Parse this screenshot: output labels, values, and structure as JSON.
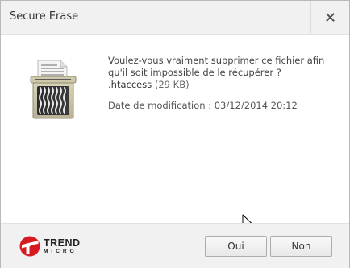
{
  "window": {
    "title": "Secure Erase",
    "close_icon": "close-icon"
  },
  "message": {
    "line1": "Voulez-vous vraiment supprimer ce fichier afin",
    "line2": "qu'il soit impossible de le récupérer ?",
    "file_name": ".htaccess",
    "file_size": "(29 KB)",
    "date_label": "Date de modification : 03/12/2014 20:12"
  },
  "icons": {
    "shredder": "shredder-icon",
    "cursor": "mouse-cursor-icon"
  },
  "footer": {
    "logo_icon": "trend-micro-logo-icon",
    "logo_trend": "TREND",
    "logo_micro": "MICRO",
    "yes_label": "Oui",
    "no_label": "Non"
  },
  "colors": {
    "titlebar_bg": "#f1f1f1",
    "footer_bg": "#f1f1f1",
    "brand_red": "#d71920",
    "text": "#444444"
  }
}
